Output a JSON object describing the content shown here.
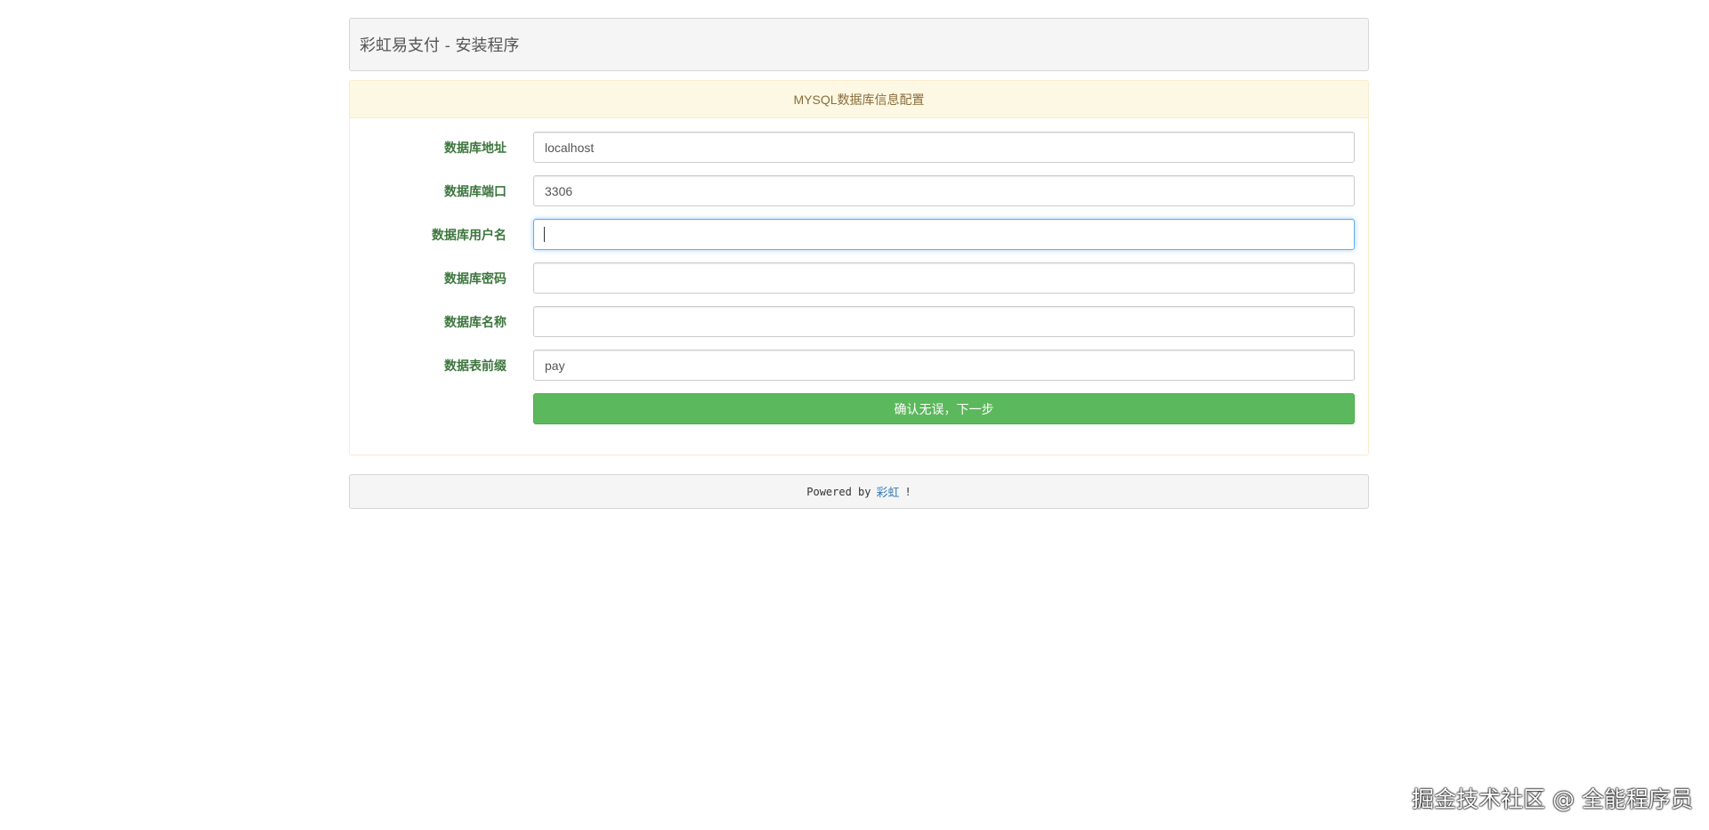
{
  "header": {
    "title": "彩虹易支付 - 安装程序"
  },
  "panel": {
    "heading": "MYSQL数据库信息配置",
    "fields": [
      {
        "label": "数据库地址",
        "value": "localhost"
      },
      {
        "label": "数据库端口",
        "value": "3306"
      },
      {
        "label": "数据库用户名",
        "value": ""
      },
      {
        "label": "数据库密码",
        "value": ""
      },
      {
        "label": "数据库名称",
        "value": ""
      },
      {
        "label": "数据表前缀",
        "value": "pay"
      }
    ],
    "submit_label": "确认无误，下一步"
  },
  "footer": {
    "prefix": "Powered by",
    "link": "彩虹",
    "suffix": "!"
  },
  "watermark": "掘金技术社区 @ 全能程序员",
  "colors": {
    "label": "#3c763d",
    "heading_text": "#8a6d3b",
    "heading_bg": "#fcf8e3",
    "button": "#5cb85c",
    "link": "#337ab7"
  }
}
